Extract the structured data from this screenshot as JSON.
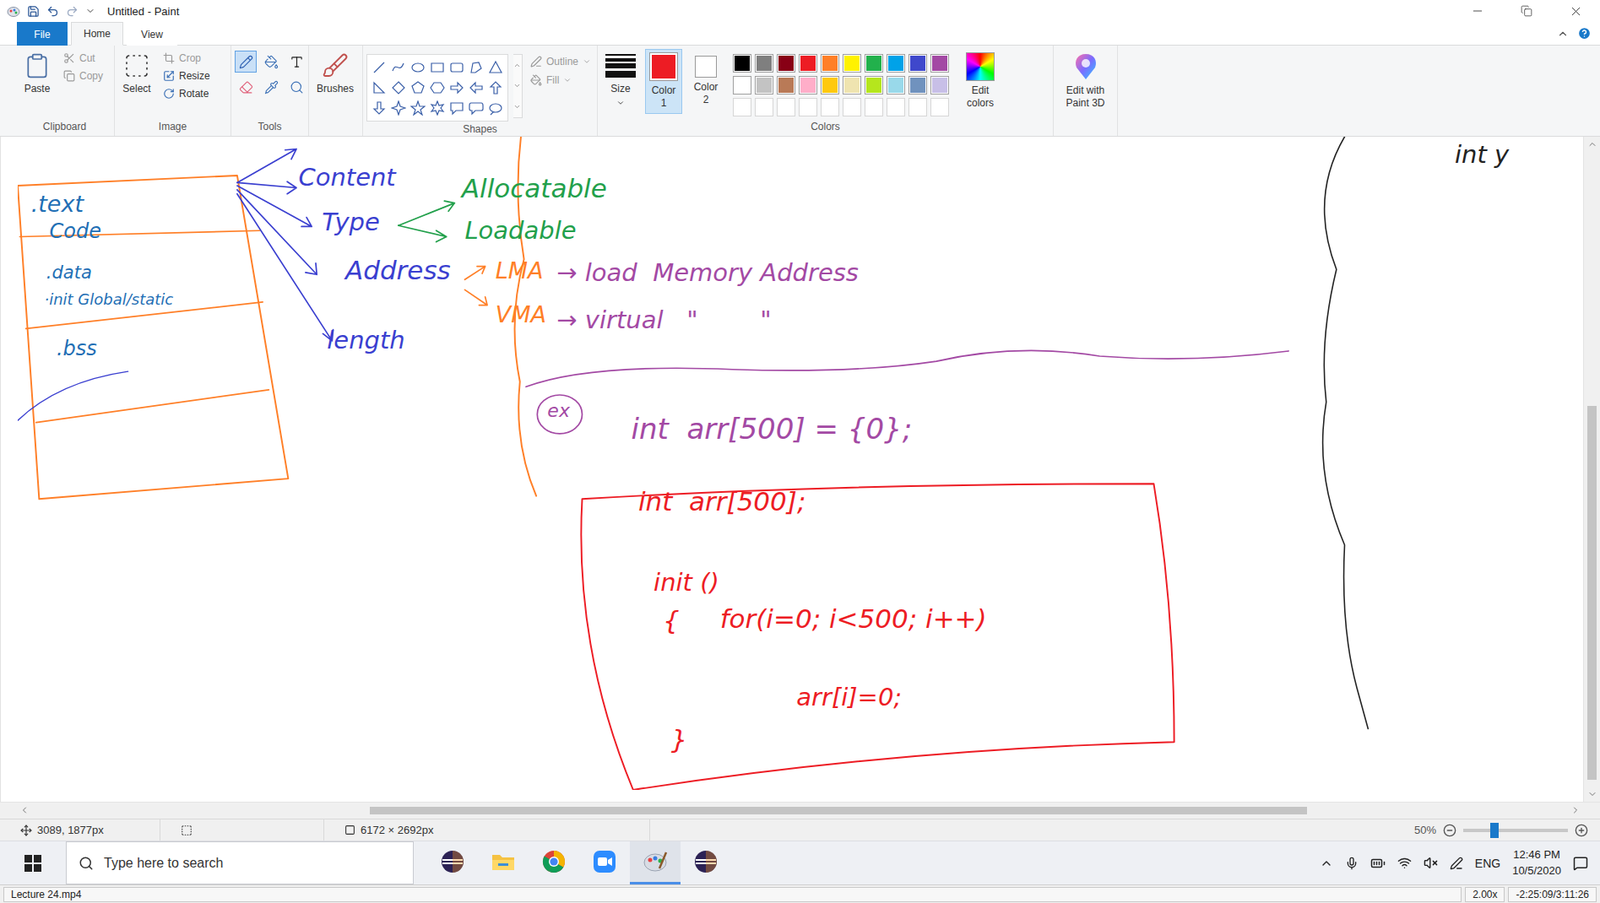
{
  "window": {
    "title": "Untitled - Paint"
  },
  "ribbon_tabs": [
    {
      "label": "File",
      "selected": false,
      "kind": "file"
    },
    {
      "label": "Home",
      "selected": true,
      "kind": "tab"
    },
    {
      "label": "View",
      "selected": false,
      "kind": "tab"
    }
  ],
  "clipboard": {
    "label": "Clipboard",
    "paste": "Paste",
    "cut": {
      "label": "Cut",
      "disabled": true
    },
    "copy": {
      "label": "Copy",
      "disabled": true
    }
  },
  "image": {
    "label": "Image",
    "select": "Select",
    "crop": {
      "label": "Crop",
      "disabled": true
    },
    "resize": {
      "label": "Resize",
      "disabled": false
    },
    "rotate": {
      "label": "Rotate",
      "disabled": false
    }
  },
  "tools": {
    "label": "Tools",
    "items": [
      {
        "kind": "pencil",
        "selected": true
      },
      {
        "kind": "fill",
        "selected": false
      },
      {
        "kind": "text",
        "selected": false
      },
      {
        "kind": "eraser",
        "selected": false
      },
      {
        "kind": "picker",
        "selected": false
      },
      {
        "kind": "magnifier",
        "selected": false
      }
    ]
  },
  "brushes": {
    "label": "Brushes"
  },
  "shapes": {
    "label": "Shapes",
    "outline": {
      "label": "Outline",
      "disabled": true
    },
    "fill": {
      "label": "Fill",
      "disabled": true
    }
  },
  "colors": {
    "label": "Colors",
    "size": "Size",
    "color1": {
      "label": "Color",
      "number": "1",
      "color": "#ed1c24",
      "selected": true
    },
    "color2": {
      "label": "Color",
      "number": "2",
      "color": "#ffffff",
      "selected": false
    },
    "palette": [
      {
        "color": "#000000"
      },
      {
        "color": "#7f7f7f"
      },
      {
        "color": "#880015"
      },
      {
        "color": "#ed1c24"
      },
      {
        "color": "#ff7f27"
      },
      {
        "color": "#fff200"
      },
      {
        "color": "#22b14c"
      },
      {
        "color": "#00a2e8"
      },
      {
        "color": "#3f48cc"
      },
      {
        "color": "#a349a4"
      },
      {
        "color": "#ffffff"
      },
      {
        "color": "#c3c3c3"
      },
      {
        "color": "#b97a57"
      },
      {
        "color": "#ffaec9"
      },
      {
        "color": "#ffc90e"
      },
      {
        "color": "#efe4b0"
      },
      {
        "color": "#b5e61d"
      },
      {
        "color": "#99d9ea"
      },
      {
        "color": "#7092be"
      },
      {
        "color": "#c8bfe7"
      },
      {
        "color": ""
      },
      {
        "color": ""
      },
      {
        "color": ""
      },
      {
        "color": ""
      },
      {
        "color": ""
      },
      {
        "color": ""
      },
      {
        "color": ""
      },
      {
        "color": ""
      },
      {
        "color": ""
      },
      {
        "color": ""
      }
    ],
    "edit": "Edit colors"
  },
  "paint3d": {
    "label": "Edit with Paint 3D"
  },
  "sketch": [
    {
      "text": ".text",
      "color": "#1f6fb5"
    },
    {
      "text": "Code",
      "color": "#1f6fb5"
    },
    {
      "text": ".data",
      "color": "#1f6fb5"
    },
    {
      "text": "·init Global/static",
      "color": "#1f6fb5"
    },
    {
      "text": ".bss",
      "color": "#1f6fb5"
    },
    {
      "text": "Content",
      "color": "#3a3fd0"
    },
    {
      "text": "Type",
      "color": "#3a3fd0"
    },
    {
      "text": "Address",
      "color": "#3a3fd0"
    },
    {
      "text": "length",
      "color": "#3a3fd0"
    },
    {
      "text": "Allocatable",
      "color": "#22a04b"
    },
    {
      "text": "Loadable",
      "color": "#22a04b"
    },
    {
      "text": "LMA",
      "color": "#ff7f27"
    },
    {
      "text": "VMA",
      "color": "#ff7f27"
    },
    {
      "text": "→ load  Memory Address",
      "color": "#a349a4"
    },
    {
      "text": "→ virtual   \"        \"",
      "color": "#a349a4"
    },
    {
      "text": "ex",
      "color": "#a349a4"
    },
    {
      "text": "int  arr[500] = {0};",
      "color": "#a349a4"
    },
    {
      "text": "int  arr[500];",
      "color": "#ed1c24"
    },
    {
      "text": "init ()",
      "color": "#ed1c24"
    },
    {
      "text": "{",
      "color": "#ed1c24"
    },
    {
      "text": "for(i=0; i<500; i++)",
      "color": "#ed1c24"
    },
    {
      "text": "arr[i]=0;",
      "color": "#ed1c24"
    },
    {
      "text": "}",
      "color": "#ed1c24"
    },
    {
      "text": "int y",
      "color": "#222222"
    }
  ],
  "scroll": {
    "horizontal": {
      "start": 0.22,
      "size": 0.61
    },
    "vertical": {
      "start": 0.4,
      "size": 0.59
    }
  },
  "status_bar": {
    "cursor": "3089, 1877px",
    "image_size": "6172 × 2692px",
    "zoom": "50%",
    "zoom_level": 0.3
  },
  "taskbar": {
    "search_placeholder": "Type here to search",
    "apps": [
      {
        "kind": "eclipse",
        "active": false
      },
      {
        "kind": "folder",
        "active": false
      },
      {
        "kind": "chrome",
        "active": false
      },
      {
        "kind": "zoom",
        "active": false
      },
      {
        "kind": "paint",
        "active": true
      },
      {
        "kind": "eclipse",
        "active": false
      }
    ],
    "language": "ENG",
    "time": "12:46 PM",
    "date": "10/5/2020"
  },
  "player": {
    "file": "Lecture 24.mp4",
    "speed": "2.00x",
    "time": "-2:25:09/3:11:26"
  }
}
